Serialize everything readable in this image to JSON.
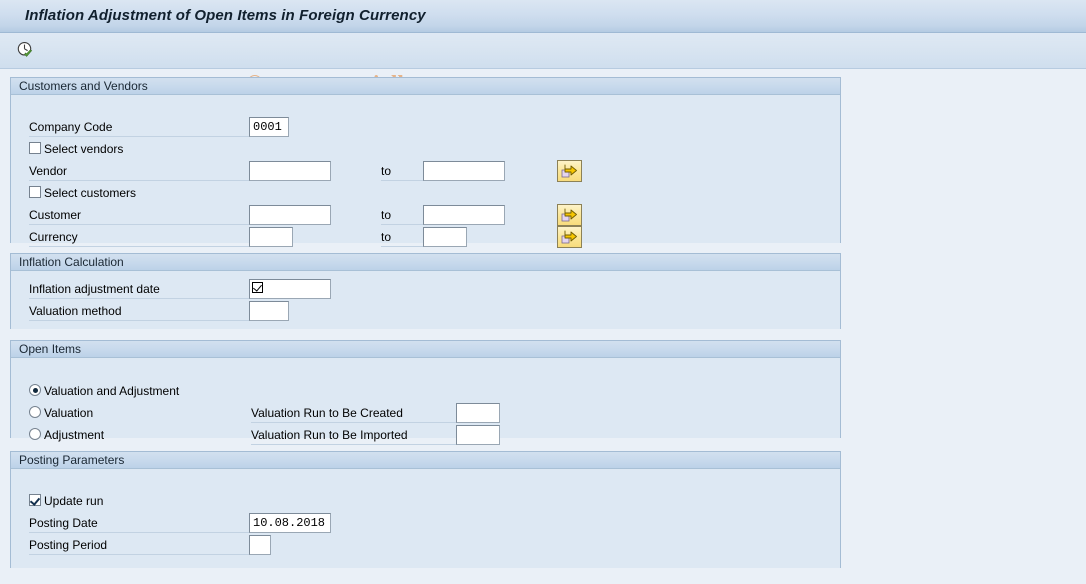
{
  "window": {
    "title": "Inflation Adjustment of Open Items in Foreign Currency"
  },
  "toolbar": {
    "execute_icon": "clock-check-icon",
    "execute_tooltip": "Execute"
  },
  "watermark": {
    "text": "© www.tutorialkart.com",
    "color": "#e6b48a"
  },
  "panels": {
    "customers_vendors": {
      "title": "Customers and Vendors",
      "company_code": {
        "label": "Company Code",
        "value": "0001"
      },
      "select_vendors": {
        "label": "Select vendors",
        "checked": false
      },
      "vendor": {
        "label": "Vendor",
        "from_value": "",
        "to_word": "to",
        "to_value": "",
        "multi_select_icon": "yellow-arrow-icon"
      },
      "select_customers": {
        "label": "Select customers",
        "checked": false
      },
      "customer": {
        "label": "Customer",
        "from_value": "",
        "to_word": "to",
        "to_value": "",
        "multi_select_icon": "yellow-arrow-icon"
      },
      "currency": {
        "label": "Currency",
        "from_value": "",
        "to_word": "to",
        "to_value": "",
        "multi_select_icon": "yellow-arrow-icon"
      }
    },
    "inflation_calculation": {
      "title": "Inflation Calculation",
      "adjustment_date": {
        "label": "Inflation adjustment date",
        "value": "",
        "glyph": "checkbox-check-glyph"
      },
      "valuation_method": {
        "label": "Valuation method",
        "value": ""
      }
    },
    "open_items": {
      "title": "Open Items",
      "options": [
        {
          "label": "Valuation and Adjustment",
          "selected": true,
          "run_label": "",
          "run_value": ""
        },
        {
          "label": "Valuation",
          "selected": false,
          "run_label": "Valuation Run to Be Created",
          "run_value": ""
        },
        {
          "label": "Adjustment",
          "selected": false,
          "run_label": "Valuation Run to Be Imported",
          "run_value": ""
        }
      ]
    },
    "posting_parameters": {
      "title": "Posting Parameters",
      "update_run": {
        "label": "Update run",
        "checked": true
      },
      "posting_date": {
        "label": "Posting Date",
        "value": "10.08.2018"
      },
      "posting_period": {
        "label": "Posting Period",
        "value": ""
      }
    }
  }
}
